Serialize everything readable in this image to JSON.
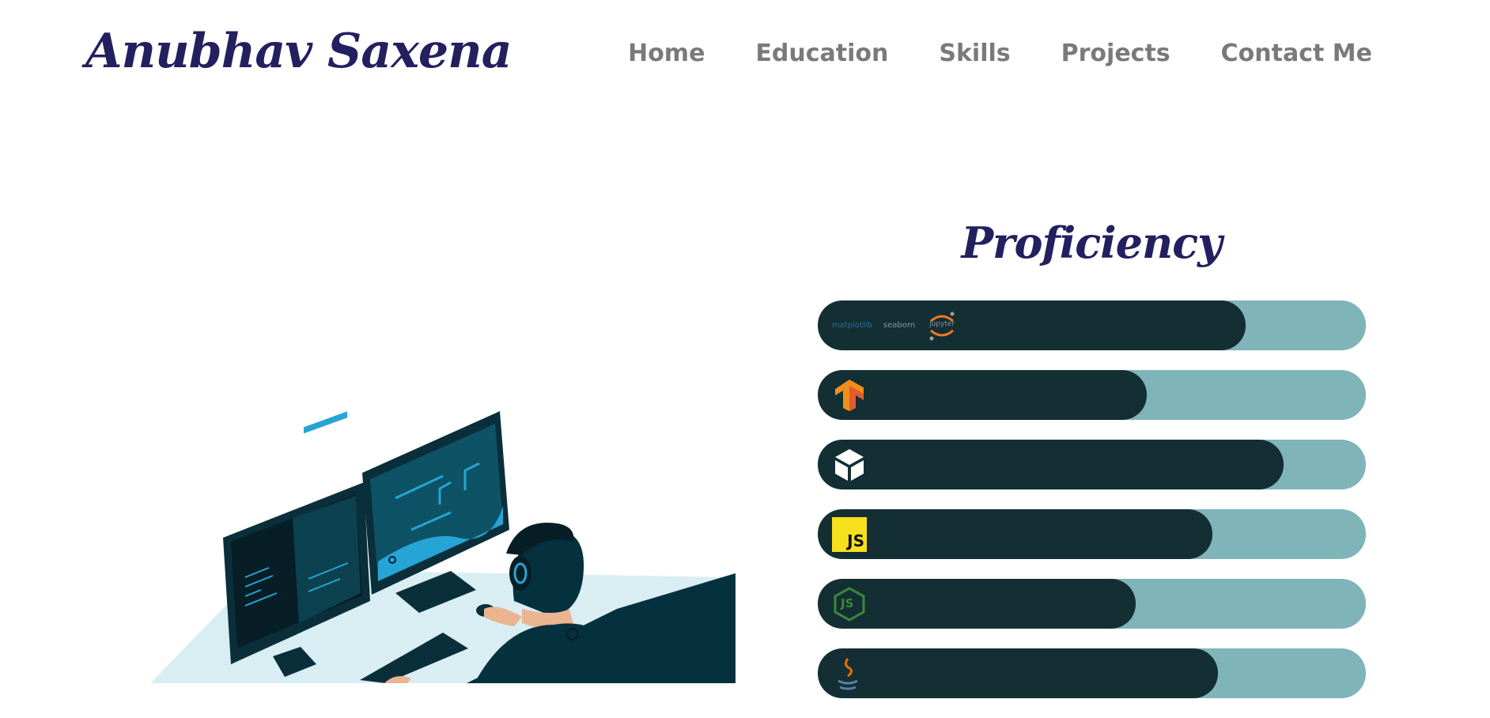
{
  "header": {
    "logo": "Anubhav Saxena",
    "nav": [
      "Home",
      "Education",
      "Skills",
      "Projects",
      "Contact Me"
    ]
  },
  "proficiency": {
    "title": "Proficiency",
    "bars": [
      {
        "icons": [
          "matplotlib-logo",
          "seaborn-logo",
          "jupyter-logo"
        ],
        "icon_texts": [
          "matplotlib",
          "seaborn",
          "jupyter"
        ],
        "level": 0.78
      },
      {
        "icons": [
          "tensorflow-logo"
        ],
        "level": 0.6
      },
      {
        "icons": [
          "blender-cube-logo"
        ],
        "level": 0.85
      },
      {
        "icons": [
          "javascript-logo"
        ],
        "icon_texts": [
          "JS"
        ],
        "level": 0.72
      },
      {
        "icons": [
          "nodejs-logo"
        ],
        "icon_texts": [
          "JS"
        ],
        "level": 0.58
      },
      {
        "icons": [
          "java-logo"
        ],
        "level": 0.73
      }
    ]
  },
  "colors": {
    "brand": "#22205f",
    "nav_text": "#7a7a7a",
    "bar_fill": "#132f33",
    "bar_track": "#7fb4b9",
    "illustration_dark": "#05313f",
    "illustration_accent": "#27a4d6",
    "js_yellow": "#f7df1e",
    "tensorflow_orange": "#f28f1c",
    "node_green": "#3c873a"
  }
}
